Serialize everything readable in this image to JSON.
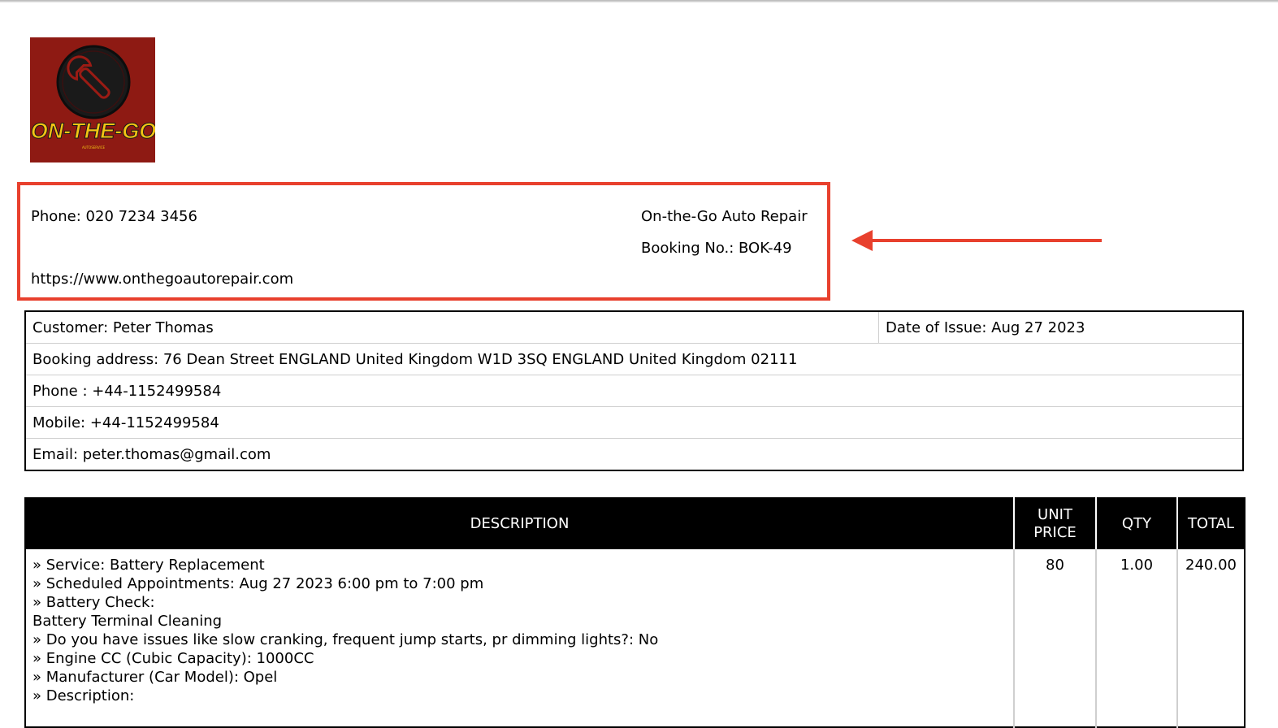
{
  "logo": {
    "brand_text": "ON-THE-GO",
    "sub_text": "AUTOSERVICE",
    "colors": {
      "background": "#8e1a13",
      "text": "#f3c414",
      "ring": "#1a1a1a"
    }
  },
  "company": {
    "phone": "Phone: 020 7234 3456",
    "website": "https://www.onthegoautorepair.com",
    "name": "On-the-Go Auto Repair",
    "booking_no": "Booking No.: BOK-49"
  },
  "annotation": {
    "highlight_color": "#e8402d"
  },
  "customer": {
    "name": "Customer: Peter Thomas",
    "date_of_issue": "Date of Issue: Aug 27 2023",
    "booking_address": "Booking address: 76 Dean Street ENGLAND United Kingdom W1D 3SQ ENGLAND United Kingdom 02111",
    "phone": "Phone : +44-1152499584",
    "mobile": "Mobile: +44-1152499584",
    "email": "Email: peter.thomas@gmail.com"
  },
  "items": {
    "headers": {
      "description": "DESCRIPTION",
      "unit_price_1": "UNIT",
      "unit_price_2": "PRICE",
      "qty": "QTY",
      "total": "TOTAL"
    },
    "rows": [
      {
        "description_lines": [
          "» Service:   Battery Replacement",
          "» Scheduled Appointments: Aug 27 2023 6:00 pm to 7:00 pm",
          "» Battery Check:",
          "Battery Terminal Cleaning",
          "» Do you have issues like slow cranking, frequent jump starts, pr dimming lights?:   No",
          "» Engine CC (Cubic Capacity):   1000CC",
          "» Manufacturer (Car Model):   Opel",
          "» Description:"
        ],
        "unit_price": "80",
        "qty": "1.00",
        "total": "240.00"
      }
    ]
  }
}
